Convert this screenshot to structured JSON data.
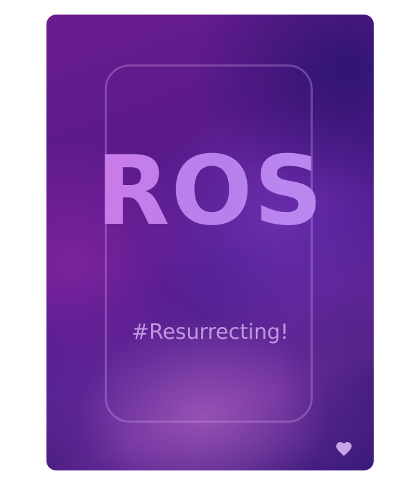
{
  "card": {
    "title": "ROS",
    "tagline": "#Resurrecting!",
    "favorite_icon": "heart-icon"
  },
  "colors": {
    "background_purple": "#5a1a8a",
    "background_indigo": "#2a1a78",
    "title_pink": "#d27ae9",
    "title_lavender": "#bb8ff2",
    "tagline": "#d2aaeb",
    "heart": "#c8a4e6"
  }
}
